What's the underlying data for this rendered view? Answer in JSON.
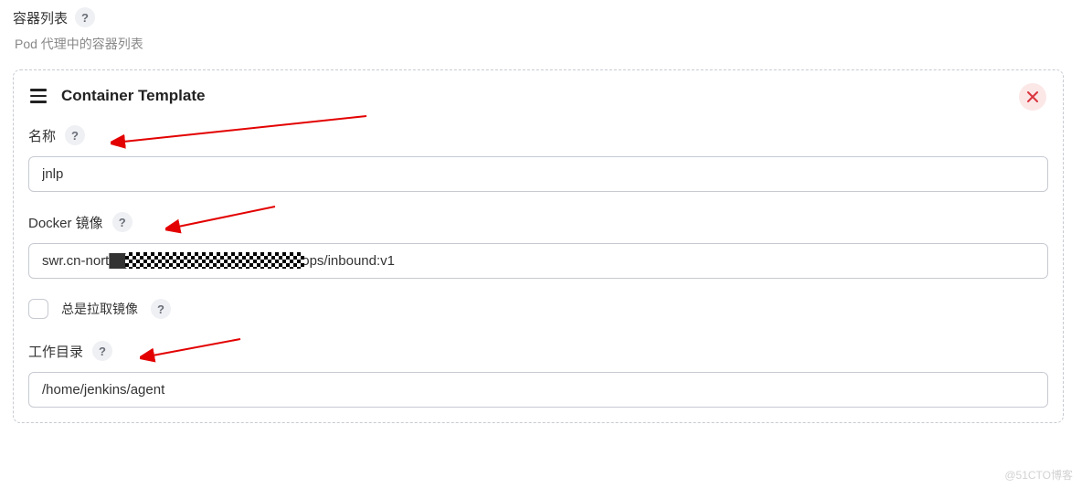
{
  "section": {
    "title": "容器列表",
    "subtitle": "Pod 代理中的容器列表"
  },
  "card": {
    "title": "Container Template",
    "fields": {
      "name": {
        "label": "名称",
        "value": "jnlp"
      },
      "dockerImage": {
        "label": "Docker 镜像",
        "value": "swr.cn-nort████████████████m/devops/inbound:v1"
      },
      "alwaysPull": {
        "label": "总是拉取镜像",
        "checked": false
      },
      "workingDir": {
        "label": "工作目录",
        "value": "/home/jenkins/agent"
      }
    }
  },
  "helpGlyph": "?",
  "watermark": "@51CTO博客"
}
